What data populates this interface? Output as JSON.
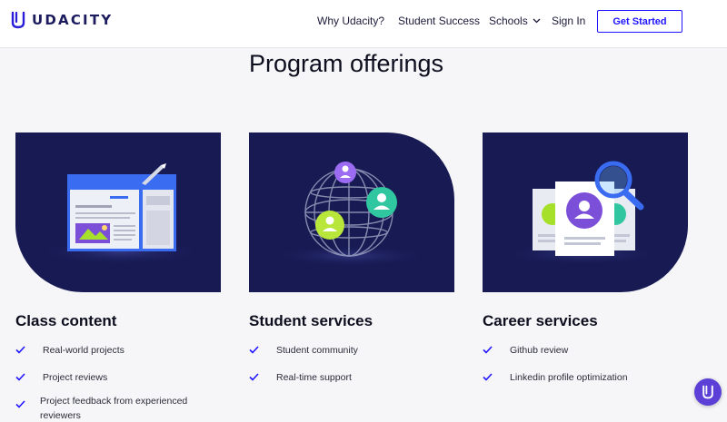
{
  "header": {
    "brand": "UDACITY",
    "nav": {
      "why": "Why Udacity?",
      "success": "Student Success",
      "schools": "Schools",
      "signin": "Sign In",
      "cta": "Get Started"
    }
  },
  "section": {
    "title": "Program offerings"
  },
  "cards": [
    {
      "title": "Class content",
      "features": [
        "Real-world projects",
        "Project reviews",
        "Project feedback from experienced reviewers"
      ]
    },
    {
      "title": "Student services",
      "features": [
        "Student community",
        "Real-time support"
      ]
    },
    {
      "title": "Career services",
      "features": [
        "Github review",
        "Linkedin profile optimization"
      ]
    }
  ],
  "colors": {
    "navy": "#171a53",
    "brand_blue": "#2015ff",
    "check_blue": "#2015ff",
    "chat_purple": "#5b3fd6"
  },
  "icons": {
    "logo": "udacity-u-logo",
    "schools_caret": "chevron-down-icon",
    "check": "check-icon",
    "chat": "udacity-chat-icon"
  }
}
